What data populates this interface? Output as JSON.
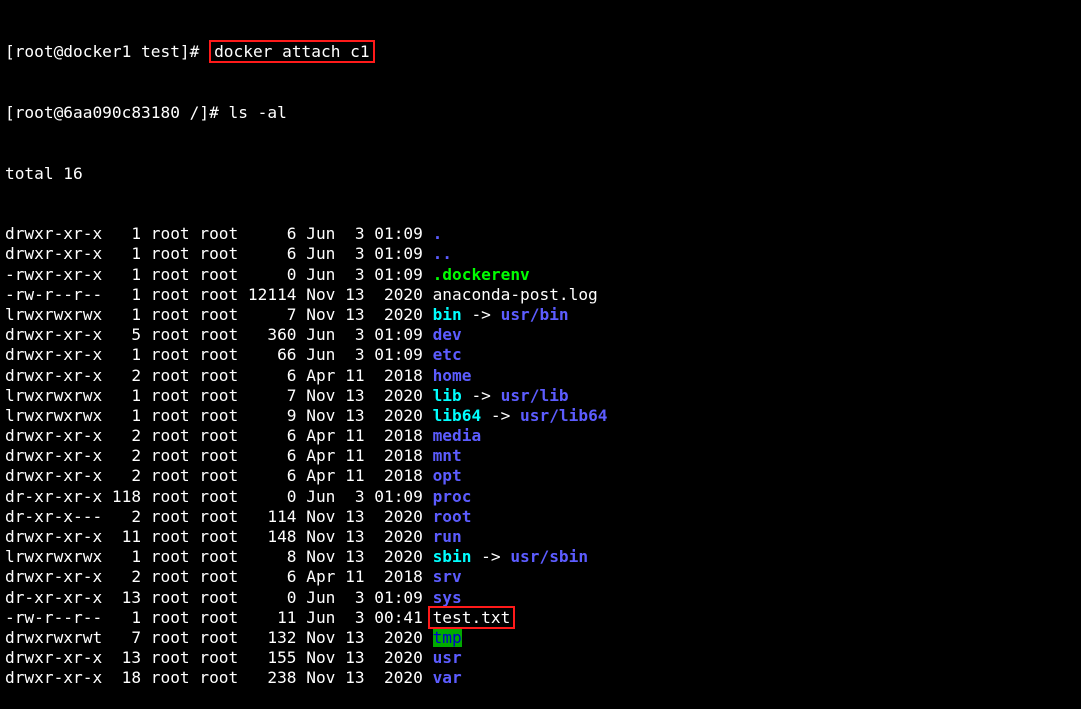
{
  "colors": {
    "background": "#000000",
    "text": "#ffffff",
    "directory": "#5c5cff",
    "symlink": "#00ffff",
    "executable": "#00ff00",
    "sticky_dir_bg": "#00aa00",
    "highlight_box": "#ff1a1a"
  },
  "prompt1": "[root@docker1 test]#",
  "command1": "docker attach c1",
  "prompt2": "[root@6aa090c83180 /]#",
  "command2": "ls -al",
  "total": "total 16",
  "entries": [
    {
      "meta": "drwxr-xr-x   1 root root     6 Jun  3 01:09",
      "name": ".",
      "kind": "dir"
    },
    {
      "meta": "drwxr-xr-x   1 root root     6 Jun  3 01:09",
      "name": "..",
      "kind": "dir"
    },
    {
      "meta": "-rwxr-xr-x   1 root root     0 Jun  3 01:09",
      "name": ".dockerenv",
      "kind": "exec"
    },
    {
      "meta": "-rw-r--r--   1 root root 12114 Nov 13  2020",
      "name": "anaconda-post.log",
      "kind": "file"
    },
    {
      "meta": "lrwxrwxrwx   1 root root     7 Nov 13  2020",
      "name": "bin",
      "kind": "link",
      "target": "usr/bin"
    },
    {
      "meta": "drwxr-xr-x   5 root root   360 Jun  3 01:09",
      "name": "dev",
      "kind": "dir"
    },
    {
      "meta": "drwxr-xr-x   1 root root    66 Jun  3 01:09",
      "name": "etc",
      "kind": "dir"
    },
    {
      "meta": "drwxr-xr-x   2 root root     6 Apr 11  2018",
      "name": "home",
      "kind": "dir"
    },
    {
      "meta": "lrwxrwxrwx   1 root root     7 Nov 13  2020",
      "name": "lib",
      "kind": "link",
      "target": "usr/lib"
    },
    {
      "meta": "lrwxrwxrwx   1 root root     9 Nov 13  2020",
      "name": "lib64",
      "kind": "link",
      "target": "usr/lib64"
    },
    {
      "meta": "drwxr-xr-x   2 root root     6 Apr 11  2018",
      "name": "media",
      "kind": "dir"
    },
    {
      "meta": "drwxr-xr-x   2 root root     6 Apr 11  2018",
      "name": "mnt",
      "kind": "dir"
    },
    {
      "meta": "drwxr-xr-x   2 root root     6 Apr 11  2018",
      "name": "opt",
      "kind": "dir"
    },
    {
      "meta": "dr-xr-xr-x 118 root root     0 Jun  3 01:09",
      "name": "proc",
      "kind": "dir"
    },
    {
      "meta": "dr-xr-x---   2 root root   114 Nov 13  2020",
      "name": "root",
      "kind": "dir"
    },
    {
      "meta": "drwxr-xr-x  11 root root   148 Nov 13  2020",
      "name": "run",
      "kind": "dir"
    },
    {
      "meta": "lrwxrwxrwx   1 root root     8 Nov 13  2020",
      "name": "sbin",
      "kind": "link",
      "target": "usr/sbin"
    },
    {
      "meta": "drwxr-xr-x   2 root root     6 Apr 11  2018",
      "name": "srv",
      "kind": "dir"
    },
    {
      "meta": "dr-xr-xr-x  13 root root     0 Jun  3 01:09",
      "name": "sys",
      "kind": "dir"
    },
    {
      "meta": "-rw-r--r--   1 root root    11 Jun  3 00:41",
      "name": "test.txt",
      "kind": "file",
      "highlighted": true
    },
    {
      "meta": "drwxrwxrwt   7 root root   132 Nov 13  2020",
      "name": "tmp",
      "kind": "tmp"
    },
    {
      "meta": "drwxr-xr-x  13 root root   155 Nov 13  2020",
      "name": "usr",
      "kind": "dir"
    },
    {
      "meta": "drwxr-xr-x  18 root root   238 Nov 13  2020",
      "name": "var",
      "kind": "dir"
    }
  ],
  "link_arrow": "->"
}
